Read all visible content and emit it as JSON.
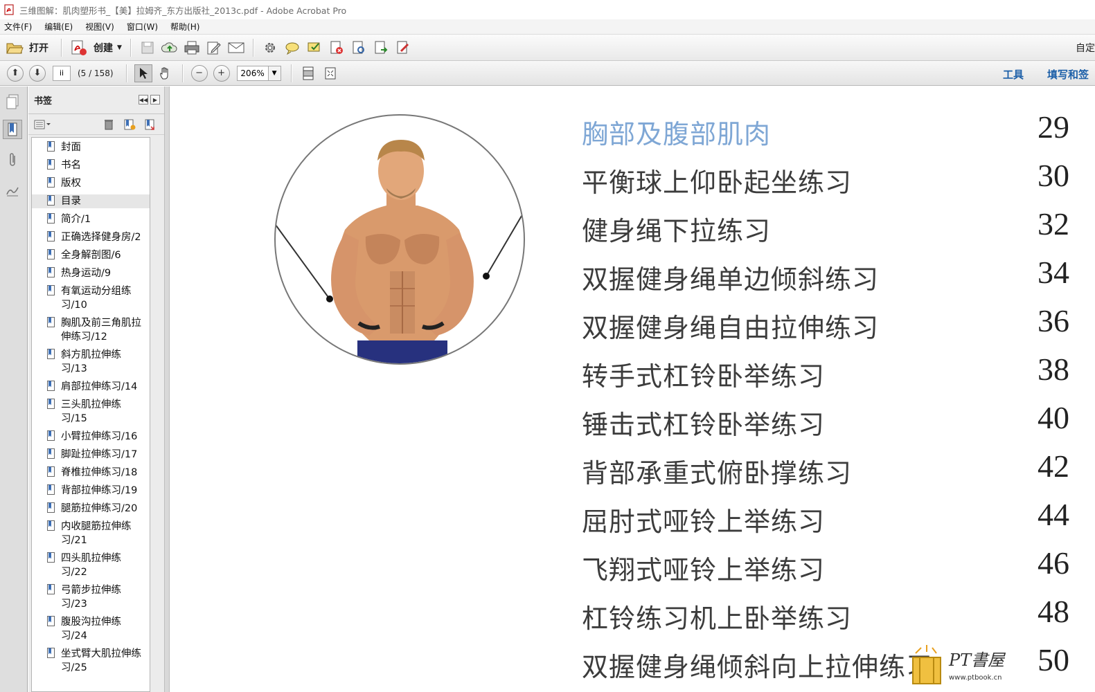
{
  "window": {
    "title": "三维图解：肌肉塑形书_【美】拉姆齐_东方出版社_2013c.pdf - Adobe Acrobat Pro"
  },
  "menu": [
    "文件(F)",
    "编辑(E)",
    "视图(V)",
    "窗口(W)",
    "帮助(H)"
  ],
  "toolbar": {
    "open_label": "打开",
    "create_label": "创建",
    "right_label": "自定"
  },
  "nav": {
    "page_field": "ii",
    "page_count": "(5 / 158)",
    "zoom": "206%",
    "tools_link": "工具",
    "fill_sign_link": "填写和签"
  },
  "bookmarks": {
    "header": "书签",
    "items": [
      "封面",
      "书名",
      "版权",
      "目录",
      "简介/1",
      "正确选择健身房/2",
      "全身解剖图/6",
      "热身运动/9",
      "有氧运动分组练习/10",
      "胸肌及前三角肌拉伸练习/12",
      "斜方肌拉伸练习/13",
      "肩部拉伸练习/14",
      "三头肌拉伸练习/15",
      "小臂拉伸练习/16",
      "脚趾拉伸练习/17",
      "脊椎拉伸练习/18",
      "背部拉伸练习/19",
      "腿筋拉伸练习/20",
      "内收腿筋拉伸练习/21",
      "四头肌拉伸练习/22",
      "弓箭步拉伸练习/23",
      "腹股沟拉伸练习/24",
      "坐式臂大肌拉伸练习/25"
    ],
    "selected_index": 3
  },
  "toc": {
    "header": "胸部及腹部肌肉",
    "header_page": "29",
    "entries": [
      {
        "title": "平衡球上仰卧起坐练习",
        "page": "30"
      },
      {
        "title": "健身绳下拉练习",
        "page": "32"
      },
      {
        "title": "双握健身绳单边倾斜练习",
        "page": "34"
      },
      {
        "title": "双握健身绳自由拉伸练习",
        "page": "36"
      },
      {
        "title": "转手式杠铃卧举练习",
        "page": "38"
      },
      {
        "title": "锤击式杠铃卧举练习",
        "page": "40"
      },
      {
        "title": "背部承重式俯卧撑练习",
        "page": "42"
      },
      {
        "title": "屈肘式哑铃上举练习",
        "page": "44"
      },
      {
        "title": "飞翔式哑铃上举练习",
        "page": "46"
      },
      {
        "title": "杠铃练习机上卧举练习",
        "page": "48"
      },
      {
        "title": "双握健身绳倾斜向上拉伸练习",
        "page": "50"
      }
    ]
  },
  "watermark": {
    "brand": "PT书屋",
    "url": "www.ptbook.cn"
  },
  "colors": {
    "toc_header": "#7fa7d5",
    "link": "#1c5fa8"
  }
}
